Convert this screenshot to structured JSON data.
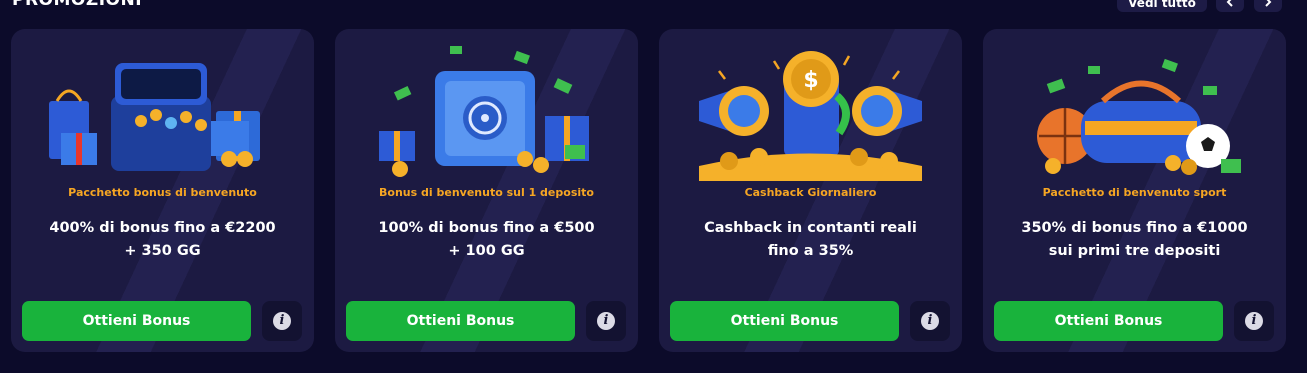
{
  "header": {
    "title": "PROMOZIONI",
    "see_all_label": "Vedi tutto"
  },
  "colors": {
    "background": "#0c0b2a",
    "card": "#1c1a42",
    "accent_orange": "#f6a623",
    "cta_green": "#19b33c"
  },
  "cards": [
    {
      "category": "Pacchetto bonus di benvenuto",
      "title": "400% di bonus fino a €2200\n+ 350 GG",
      "button_label": "Ottieni Bonus",
      "illustration": "treasure-chest-gifts-icon"
    },
    {
      "category": "Bonus di benvenuto sul 1 deposito",
      "title": "100% di bonus fino a €500\n+ 100 GG",
      "button_label": "Ottieni Bonus",
      "illustration": "safe-money-icon"
    },
    {
      "category": "Cashback Giornaliero",
      "title": "Cashback in contanti reali\nfino a 35%",
      "button_label": "Ottieni Bonus",
      "illustration": "megaphone-coins-icon"
    },
    {
      "category": "Pacchetto di benvenuto sport",
      "title": "350% di bonus fino a €1000\nsui primi tre depositi",
      "button_label": "Ottieni Bonus",
      "illustration": "sports-bag-balls-icon"
    }
  ]
}
